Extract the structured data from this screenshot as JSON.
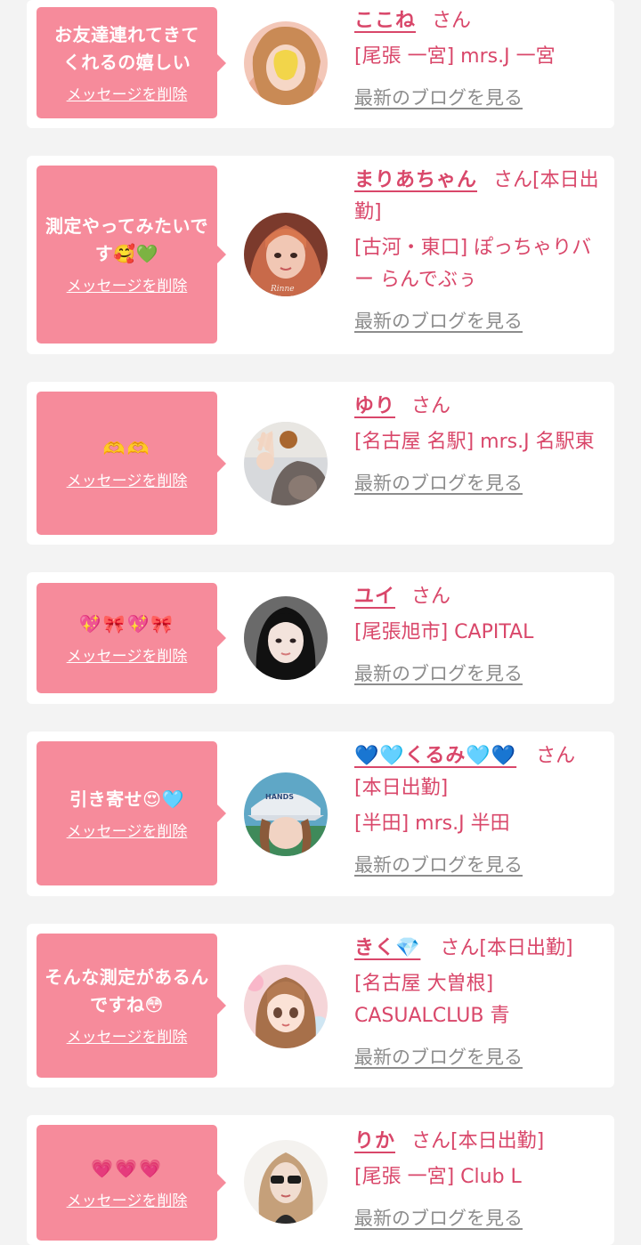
{
  "common": {
    "delete_label": "メッセージを削除",
    "blog_label": "最新のブログを見る",
    "san_suffix": "さん"
  },
  "colors": {
    "bubble_bg": "#f68b9b",
    "name_color": "#d9476a",
    "blog_color": "#8c8c8c",
    "page_bg": "#f3f3f3",
    "card_bg": "#ffffff"
  },
  "items": [
    {
      "message": "お友達連れてきてくれるの嬉しい",
      "name": "ここね",
      "status": "",
      "shop": "[尾張 一宮] mrs.J 一宮"
    },
    {
      "message": "測定やってみたいです🥰💚",
      "name": "まりあちゃん",
      "status": "[本日出勤]",
      "shop": "[古河・東口] ぽっちゃりバー らんでぶぅ"
    },
    {
      "message": "🫶🫶",
      "name": "ゆり",
      "status": "",
      "shop": "[名古屋 名駅] mrs.J 名駅東"
    },
    {
      "message": "💖🎀💖🎀",
      "name": "ユイ",
      "status": "",
      "shop": "[尾張旭市] CAPITAL"
    },
    {
      "message": "引き寄せ😍🩵",
      "name": "💙🩵くるみ🩵💙",
      "status": "[本日出勤]",
      "shop": "[半田] mrs.J 半田"
    },
    {
      "message": "そんな測定があるんですね😳",
      "name": "きく💎",
      "status": "[本日出勤]",
      "shop": "[名古屋 大曽根] CASUALCLUB 青"
    },
    {
      "message": "💗💗💗",
      "name": "りか",
      "status": "[本日出勤]",
      "shop": "[尾張 一宮] Club L"
    }
  ]
}
